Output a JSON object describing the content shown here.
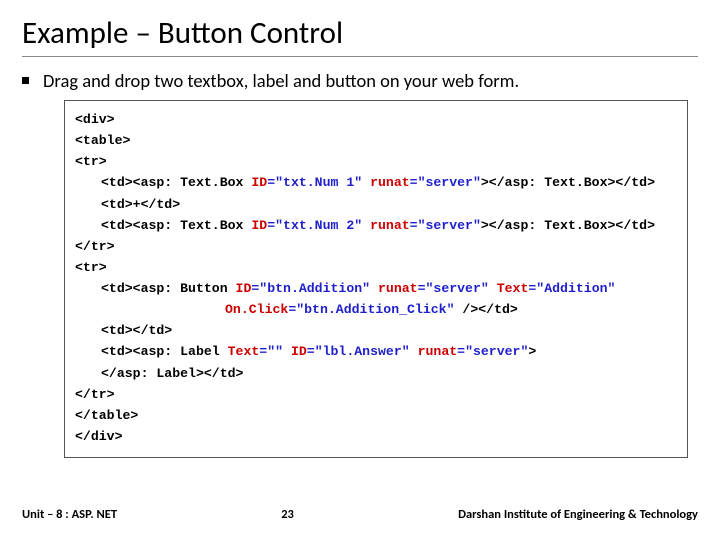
{
  "title": "Example – Button Control",
  "bullet": "Drag and drop two textbox, label and button on your web form.",
  "code": {
    "l1": "<div>",
    "l2": "<table>",
    "l3": "<tr>",
    "l4a": "<td><asp: Text.Box ",
    "l4_id": "ID",
    "l4_idv": "=\"txt.Num 1\"",
    "l4_run": " runat",
    "l4_runv": "=\"server\"",
    "l4b": "></asp: Text.Box></td>",
    "l5": "<td>+</td>",
    "l6a": "<td><asp: Text.Box ",
    "l6_id": "ID",
    "l6_idv": "=\"txt.Num 2\"",
    "l6_run": " runat",
    "l6_runv": "=\"server\"",
    "l6b": "></asp: Text.Box></td>",
    "l7": "</tr>",
    "l8": "<tr>",
    "l9a": "<td><asp: Button ",
    "l9_id": "ID",
    "l9_idv": "=\"btn.Addition\"",
    "l9_run": " runat",
    "l9_runv": "=\"server\"",
    "l9_txt": " Text",
    "l9_txtv": "=\"Addition\"",
    "l10_oc": "On.Click",
    "l10_ocv": "=\"btn.Addition_Click\"",
    "l10b": " /></td>",
    "l11": "<td></td>",
    "l12a": "<td><asp: Label ",
    "l12_txt": "Text",
    "l12_txtv": "=\"\"",
    "l12_id": " ID",
    "l12_idv": "=\"lbl.Answer\"",
    "l12_run": " runat",
    "l12_runv": "=\"server\"",
    "l12b": ">",
    "l13": "</asp: Label></td>",
    "l14": "</tr>",
    "l15": "</table>",
    "l16": "</div>"
  },
  "footer": {
    "left": "Unit – 8 : ASP. NET",
    "center": "23",
    "right": "Darshan Institute of Engineering & Technology"
  }
}
